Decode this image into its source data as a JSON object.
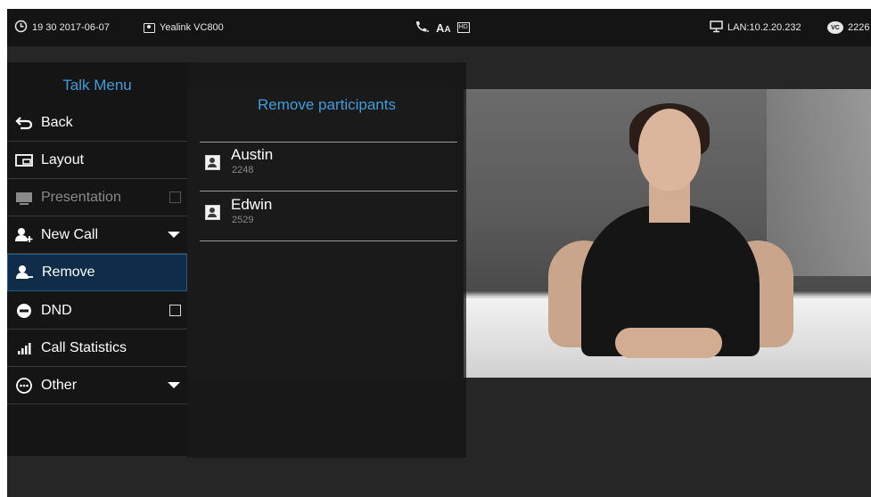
{
  "status_bar": {
    "datetime": "19 30 2017-06-07",
    "device_name": "Yealink VC800",
    "lan": "LAN:10.2.20.232",
    "vc_badge": "VC",
    "extension": "2226",
    "codec_badge": "HD",
    "icons": [
      "clock-icon",
      "contact-card-icon",
      "phone-handset-icon",
      "font-size-icon",
      "hd-badge-icon",
      "network-monitor-icon",
      "vc-icon"
    ]
  },
  "talk_menu": {
    "title": "Talk Menu",
    "items": [
      {
        "label": "Back",
        "icon": "back-arrow-icon"
      },
      {
        "label": "Layout",
        "icon": "layout-icon"
      },
      {
        "label": "Presentation",
        "icon": "presentation-icon",
        "enabled": false,
        "checked": false
      },
      {
        "label": "New Call",
        "icon": "add-person-icon",
        "expandable": true
      },
      {
        "label": "Remove",
        "icon": "remove-person-icon",
        "selected": true
      },
      {
        "label": "DND",
        "icon": "dnd-icon",
        "checked": false
      },
      {
        "label": "Call Statistics",
        "icon": "signal-bars-icon"
      },
      {
        "label": "Other",
        "icon": "more-icon",
        "expandable": true
      }
    ]
  },
  "remove_panel": {
    "title": "Remove participants",
    "participants": [
      {
        "name": "Austin",
        "number": "2248"
      },
      {
        "name": "Edwin",
        "number": "2529"
      }
    ]
  },
  "colors": {
    "accent": "#3d9ddd",
    "menu_bg": "#151515",
    "selected_bg": "#0f2d48",
    "status_bar_bg": "#141414"
  }
}
